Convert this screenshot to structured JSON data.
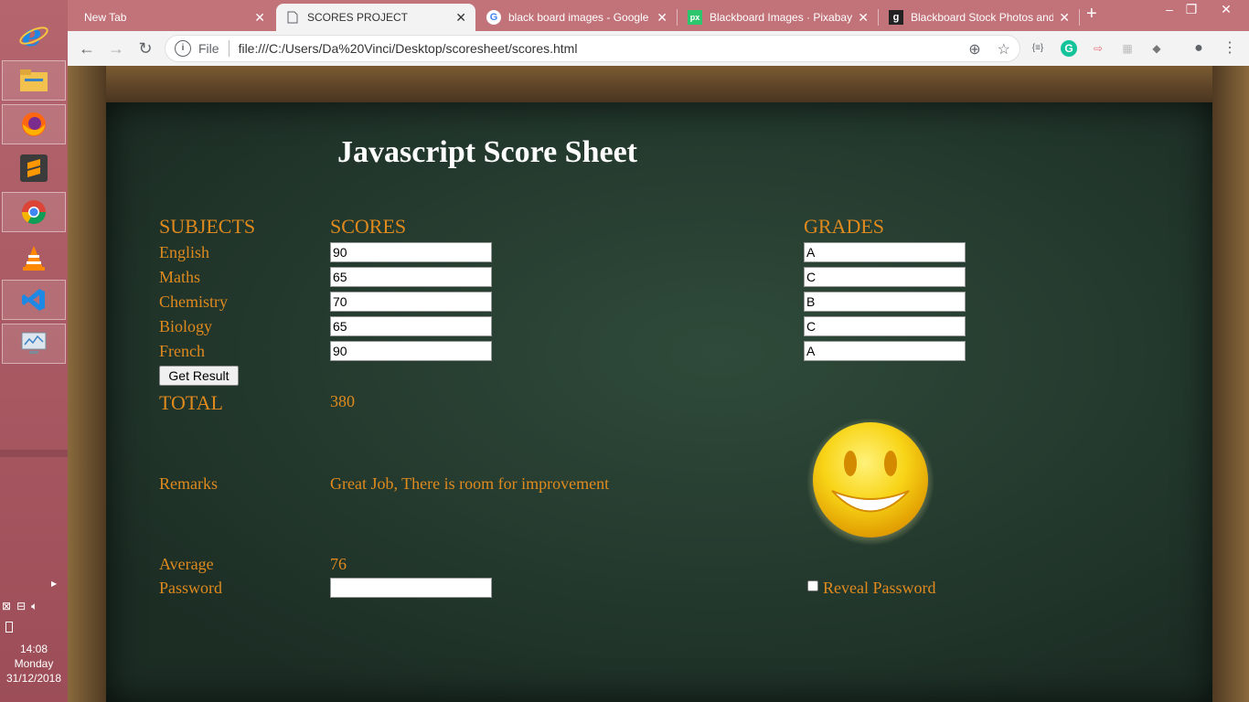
{
  "taskbar": {
    "apps": [
      "internet-explorer",
      "file-explorer",
      "firefox",
      "sublime-text",
      "chrome",
      "vlc",
      "visual-studio-code",
      "system-monitor"
    ],
    "clock": {
      "time": "14:08",
      "day": "Monday",
      "date": "31/12/2018"
    }
  },
  "browser": {
    "tabs": [
      {
        "title": "New Tab"
      },
      {
        "title": "SCORES PROJECT"
      },
      {
        "title": "black board images - Google"
      },
      {
        "title": "Blackboard Images · Pixabay ·"
      },
      {
        "title": "Blackboard Stock Photos and"
      }
    ],
    "address": {
      "scheme": "File",
      "url": "file:///C:/Users/Da%20Vinci/Desktop/scoresheet/scores.html"
    }
  },
  "page": {
    "title": "Javascript Score Sheet",
    "headers": {
      "subjects": "SUBJECTS",
      "scores": "SCORES",
      "grades": "GRADES"
    },
    "rows": [
      {
        "subject": "English",
        "score": "90",
        "grade": "A"
      },
      {
        "subject": "Maths",
        "score": "65",
        "grade": "C"
      },
      {
        "subject": "Chemistry",
        "score": "70",
        "grade": "B"
      },
      {
        "subject": "Biology",
        "score": "65",
        "grade": "C"
      },
      {
        "subject": "French",
        "score": "90",
        "grade": "A"
      }
    ],
    "get_result_label": "Get Result",
    "total_label": "TOTAL",
    "total_value": "380",
    "remarks_label": "Remarks",
    "remarks_value": "Great Job, There is room for improvement",
    "average_label": "Average",
    "average_value": "76",
    "password_label": "Password",
    "password_value": "",
    "reveal_label": "Reveal Password"
  },
  "colors": {
    "accent": "#e08a1e",
    "board": "#243a2e",
    "tabstrip": "#c27279",
    "taskbar": "#b5656d"
  }
}
